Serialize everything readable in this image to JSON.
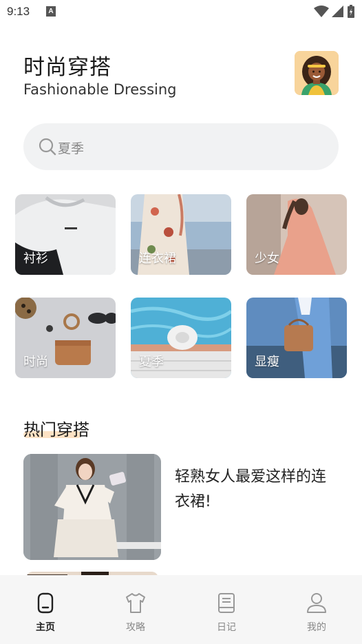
{
  "status_bar": {
    "time": "9:13",
    "notification_icon": "A"
  },
  "header": {
    "title": "时尚穿搭",
    "subtitle": "Fashionable Dressing",
    "avatar_icon": "user-avatar"
  },
  "search": {
    "placeholder": "夏季",
    "icon": "search-icon"
  },
  "categories": [
    {
      "label": "衬衫"
    },
    {
      "label": "连衣裙"
    },
    {
      "label": "少女"
    },
    {
      "label": "时尚"
    },
    {
      "label": "夏季"
    },
    {
      "label": "显瘦"
    }
  ],
  "hot_section": {
    "title": "热门穿搭",
    "articles": [
      {
        "title": "轻熟女人最爱这样的连衣裙!"
      }
    ]
  },
  "tab_bar": {
    "tabs": [
      {
        "label": "主页",
        "icon": "home-icon",
        "active": true
      },
      {
        "label": "攻略",
        "icon": "shirt-icon",
        "active": false
      },
      {
        "label": "日记",
        "icon": "diary-icon",
        "active": false
      },
      {
        "label": "我的",
        "icon": "user-icon",
        "active": false
      }
    ]
  },
  "colors": {
    "accent_underline": "#fde2c4",
    "search_bg": "#f1f2f3",
    "tab_bar_bg": "#f6f6f6"
  }
}
